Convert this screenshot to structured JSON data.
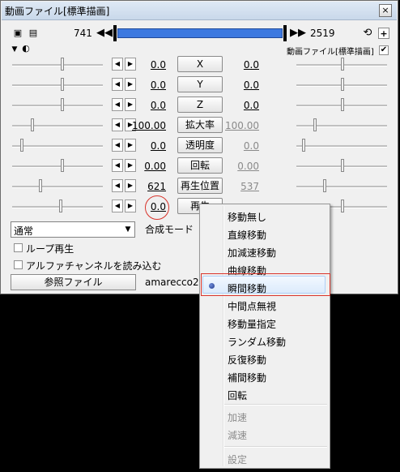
{
  "window": {
    "title": "動画ファイル[標準描画]",
    "close_glyph": "×"
  },
  "toolbar": {
    "frame_start": "741",
    "frame_end": "2519",
    "object_label": "動画ファイル[標準描画]",
    "object_checked": true
  },
  "params": [
    {
      "left": "0.0",
      "button": "X",
      "right": "0.0",
      "right_grey": false
    },
    {
      "left": "0.0",
      "button": "Y",
      "right": "0.0",
      "right_grey": false
    },
    {
      "left": "0.0",
      "button": "Z",
      "right": "0.0",
      "right_grey": false
    },
    {
      "left": "100.00",
      "button": "拡大率",
      "right": "100.00",
      "right_grey": true
    },
    {
      "left": "0.0",
      "button": "透明度",
      "right": "0.0",
      "right_grey": true
    },
    {
      "left": "0.00",
      "button": "回転",
      "right": "0.00",
      "right_grey": true
    },
    {
      "left": "621",
      "button": "再生位置",
      "right": "537",
      "right_grey": true
    },
    {
      "left": "0.0",
      "button": "再生",
      "right": "",
      "right_grey": true
    }
  ],
  "blend": {
    "value": "通常",
    "label": "合成モード"
  },
  "options": {
    "loop_label": "ループ再生",
    "alpha_label": "アルファチャンネルを読み込む"
  },
  "file": {
    "button_label": "参照ファイル",
    "filename": "amarecco20"
  },
  "menu": {
    "items": [
      "移動無し",
      "直線移動",
      "加減速移動",
      "曲線移動",
      "瞬間移動",
      "中間点無視",
      "移動量指定",
      "ランダム移動",
      "反復移動",
      "補間移動",
      "回転"
    ],
    "selected": "瞬間移動",
    "accel": "加速",
    "decel": "減速",
    "settings": "設定"
  },
  "colors": {
    "seekbar": "#3d79e0",
    "highlight_outline": "#d9342b"
  }
}
